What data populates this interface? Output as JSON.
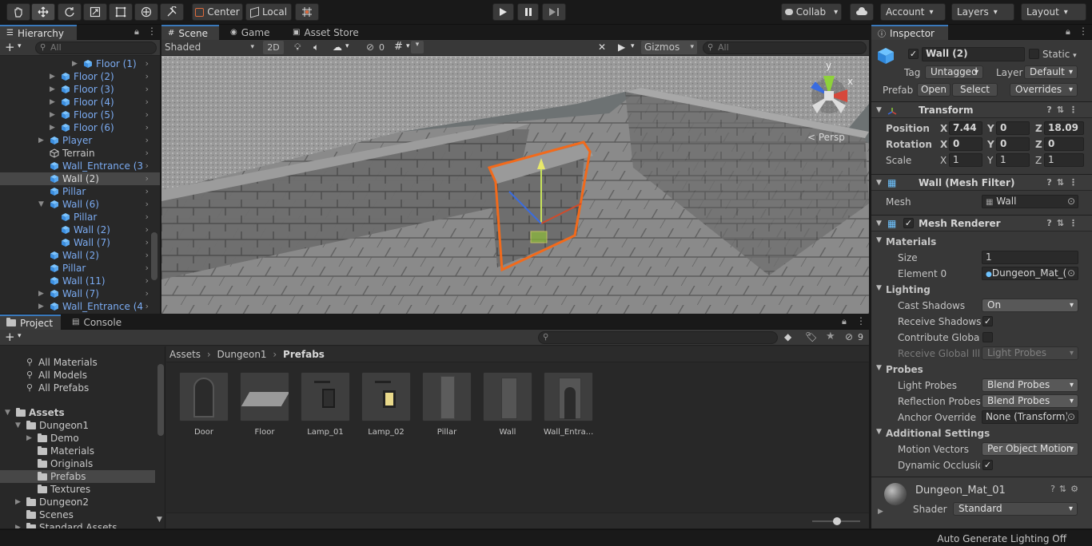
{
  "toolbar": {
    "pivot": "Center",
    "space": "Local",
    "collab": "Collab",
    "account": "Account",
    "layers": "Layers",
    "layout": "Layout"
  },
  "hierarchy": {
    "tab": "Hierarchy",
    "search_placeholder": "All",
    "items": [
      {
        "label": "Floor (1)"
      },
      {
        "label": "Floor (2)"
      },
      {
        "label": "Floor (3)"
      },
      {
        "label": "Floor (4)"
      },
      {
        "label": "Floor (5)"
      },
      {
        "label": "Floor (6)"
      },
      {
        "label": "Player"
      },
      {
        "label": "Terrain"
      },
      {
        "label": "Wall_Entrance (3"
      },
      {
        "label": "Wall (2)"
      },
      {
        "label": "Pillar"
      },
      {
        "label": "Wall (6)"
      },
      {
        "label": "Pillar"
      },
      {
        "label": "Wall (2)"
      },
      {
        "label": "Wall (7)"
      },
      {
        "label": "Wall (2)"
      },
      {
        "label": "Pillar"
      },
      {
        "label": "Wall (11)"
      },
      {
        "label": "Wall (7)"
      },
      {
        "label": "Wall_Entrance (4"
      }
    ]
  },
  "scene": {
    "tabs": [
      "Scene",
      "Game",
      "Asset Store"
    ],
    "shading": "Shaded",
    "mode_2d": "2D",
    "hidden_count": "0",
    "gizmos": "Gizmos",
    "search_placeholder": "All",
    "persp": "< Persp",
    "axis_y": "y",
    "axis_x": "x"
  },
  "project": {
    "tabs": [
      "Project",
      "Console"
    ],
    "hidden_count": "9",
    "favorites": [
      "All Materials",
      "All Models",
      "All Prefabs"
    ],
    "tree": [
      {
        "label": "Assets"
      },
      {
        "label": "Dungeon1"
      },
      {
        "label": "Demo"
      },
      {
        "label": "Materials"
      },
      {
        "label": "Originals"
      },
      {
        "label": "Prefabs"
      },
      {
        "label": "Textures"
      },
      {
        "label": "Dungeon2"
      },
      {
        "label": "Scenes"
      },
      {
        "label": "Standard Assets"
      }
    ],
    "breadcrumb": [
      "Assets",
      "Dungeon1",
      "Prefabs"
    ],
    "assets": [
      {
        "label": "Door"
      },
      {
        "label": "Floor"
      },
      {
        "label": "Lamp_01"
      },
      {
        "label": "Lamp_02"
      },
      {
        "label": "Pillar"
      },
      {
        "label": "Wall"
      },
      {
        "label": "Wall_Entra..."
      }
    ]
  },
  "inspector": {
    "tab": "Inspector",
    "object_name": "Wall (2)",
    "static": "Static",
    "tag_label": "Tag",
    "tag": "Untagged",
    "layer_label": "Layer",
    "layer": "Default",
    "prefab_label": "Prefab",
    "open": "Open",
    "select": "Select",
    "overrides": "Overrides",
    "transform": {
      "title": "Transform",
      "position_label": "Position",
      "rotation_label": "Rotation",
      "scale_label": "Scale",
      "position": {
        "x": "7.44",
        "y": "0",
        "z": "18.09"
      },
      "rotation": {
        "x": "0",
        "y": "0",
        "z": "0"
      },
      "scale": {
        "x": "1",
        "y": "1",
        "z": "1"
      }
    },
    "mesh_filter": {
      "title": "Wall (Mesh Filter)",
      "mesh_label": "Mesh",
      "mesh": "Wall"
    },
    "mesh_renderer": {
      "title": "Mesh Renderer",
      "materials_label": "Materials",
      "size_label": "Size",
      "size": "1",
      "element0_label": "Element 0",
      "element0": "Dungeon_Mat_(",
      "lighting_label": "Lighting",
      "cast_shadows_label": "Cast Shadows",
      "cast_shadows": "On",
      "receive_shadows_label": "Receive Shadows",
      "contribute_gi_label": "Contribute Global I",
      "receive_gi_label": "Receive Global Illu",
      "receive_gi": "Light Probes",
      "probes_label": "Probes",
      "light_probes_label": "Light Probes",
      "light_probes": "Blend Probes",
      "reflection_probes_label": "Reflection Probes",
      "reflection_probes": "Blend Probes",
      "anchor_override_label": "Anchor Override",
      "anchor_override": "None (Transform)",
      "additional_label": "Additional Settings",
      "motion_vectors_label": "Motion Vectors",
      "motion_vectors": "Per Object Motion",
      "dynamic_occlusion_label": "Dynamic Occlusio"
    },
    "material": {
      "name": "Dungeon_Mat_01",
      "shader_label": "Shader",
      "shader": "Standard"
    }
  },
  "status": {
    "message": "Auto Generate Lighting Off"
  },
  "colors": {
    "accent": "#3a79bb",
    "selection_outline": "#f26a1b",
    "hierarchy_link": "#7aaaf0"
  }
}
